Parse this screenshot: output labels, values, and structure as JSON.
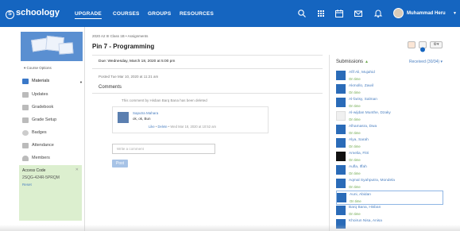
{
  "header": {
    "logo": "schoology",
    "nav": [
      "UPGRADE",
      "COURSES",
      "GROUPS",
      "RESOURCES"
    ],
    "user_name": "Muhammad Heru"
  },
  "sidebar": {
    "course_options": "Course Options",
    "items": [
      {
        "label": "Materials",
        "icon": "materials-icon"
      },
      {
        "label": "Updates",
        "icon": "updates-icon"
      },
      {
        "label": "Gradebook",
        "icon": "gradebook-icon"
      },
      {
        "label": "Grade Setup",
        "icon": "grade-setup-icon"
      },
      {
        "label": "Badges",
        "icon": "badges-icon"
      },
      {
        "label": "Attendance",
        "icon": "attendance-icon"
      },
      {
        "label": "Members",
        "icon": "members-icon"
      }
    ],
    "access_code": {
      "title": "Access Code",
      "code": "2SQG-424R-5PRQM",
      "reset": "Reset"
    }
  },
  "main": {
    "breadcrumb": "2020 A2 III Class 1B • Assignments",
    "title": "Pin 7 - Programming",
    "due": "Due: Wednesday, March 18, 2020 at 5:00 pm",
    "posted": "Posted Tue Mar 10, 2020 at 11:21 am",
    "comments_heading": "Comments",
    "deleted_notice": "This comment by Hisban Barq Bana has been deleted",
    "comment": {
      "author": "Saputra Mahara",
      "text": "ok, ok, Bun",
      "like": "Like",
      "delete": "Delete",
      "time": "Wed Mar 18, 2020 at 10:52 am"
    },
    "write_placeholder": "Write a comment",
    "post_label": "Post",
    "settings_label": "⚙▾"
  },
  "submissions": {
    "title": "Submissions",
    "received": "Received (30/34)",
    "rows": [
      {
        "name": "Afif Ali, Mujahid",
        "status": "On time"
      },
      {
        "name": "Akmollo, Zawil",
        "status": "On time"
      },
      {
        "name": "Al-farisy, Salman",
        "status": "On time"
      },
      {
        "name": "Al-wijdan Munthe, Dzaky",
        "status": "On time"
      },
      {
        "name": "Alhamasra, Dwa",
        "status": "On time"
      },
      {
        "name": "Alya, Sarah",
        "status": "On time"
      },
      {
        "name": "Amelia, Fitri",
        "status": "On time"
      },
      {
        "name": "Aufla, Iffah",
        "status": "On time"
      },
      {
        "name": "Aqmal Syahputra, Mondela",
        "status": "On time"
      },
      {
        "name": "Auni, Abidan",
        "status": "On time"
      },
      {
        "name": "Barq Bana, Hisban",
        "status": "On time"
      },
      {
        "name": "Khoirun Nisa, Anisa",
        "status": ""
      }
    ]
  }
}
